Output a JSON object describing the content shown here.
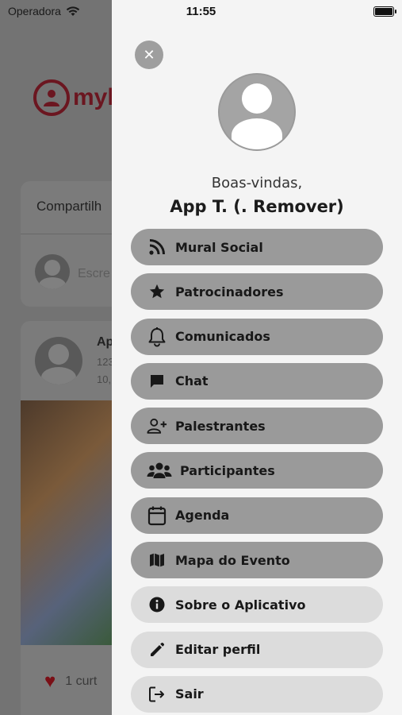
{
  "status_bar": {
    "carrier": "Operadora",
    "time": "11:55"
  },
  "background": {
    "logo_text": "myl",
    "share_title": "Compartilh",
    "share_placeholder": "Escre",
    "post_name": "Ap",
    "post_meta1": "123",
    "post_meta2": "10,",
    "likes_text": "1 curt"
  },
  "drawer": {
    "close_glyph": "✕",
    "greeting": "Boas-vindas,",
    "username": "App T. (. Remover)",
    "menu": [
      {
        "label": "Mural Social",
        "icon": "rss-icon",
        "style": "dark"
      },
      {
        "label": "Patrocinadores",
        "icon": "star-icon",
        "style": "dark"
      },
      {
        "label": "Comunicados",
        "icon": "bell-icon",
        "style": "dark"
      },
      {
        "label": "Chat",
        "icon": "chat-bubble-icon",
        "style": "dark"
      },
      {
        "label": "Palestrantes",
        "icon": "person-add-icon",
        "style": "dark"
      },
      {
        "label": "Participantes",
        "icon": "people-icon",
        "style": "dark"
      },
      {
        "label": "Agenda",
        "icon": "calendar-icon",
        "style": "dark"
      },
      {
        "label": "Mapa do Evento",
        "icon": "map-icon",
        "style": "dark"
      },
      {
        "label": "Sobre o Aplicativo",
        "icon": "info-icon",
        "style": "light"
      },
      {
        "label": "Editar perfil",
        "icon": "pencil-icon",
        "style": "light"
      },
      {
        "label": "Sair",
        "icon": "logout-icon",
        "style": "light"
      }
    ]
  },
  "colors": {
    "drawer_bg": "#f4f4f4",
    "menu_dark": "#9a9a9a",
    "menu_light": "#dcdcdc",
    "brand": "#6b1620"
  }
}
